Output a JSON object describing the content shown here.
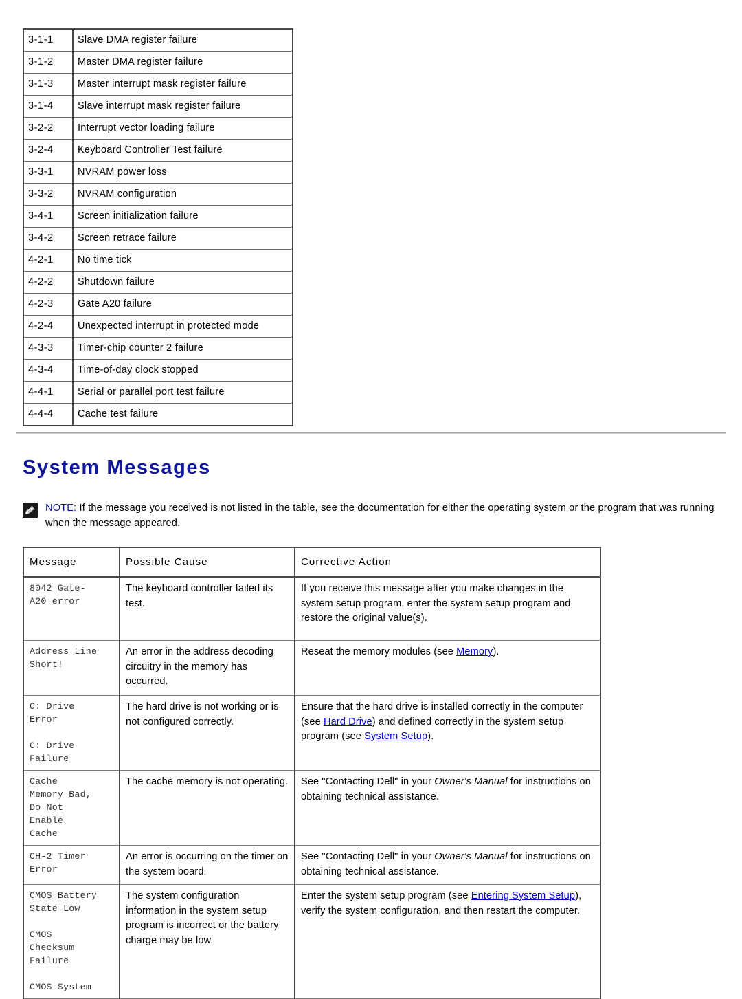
{
  "beep_table": {
    "rows": [
      {
        "code": "3-1-1",
        "desc": "Slave DMA register failure"
      },
      {
        "code": "3-1-2",
        "desc": "Master DMA register failure"
      },
      {
        "code": "3-1-3",
        "desc": "Master interrupt mask register failure"
      },
      {
        "code": "3-1-4",
        "desc": "Slave interrupt mask register failure"
      },
      {
        "code": "3-2-2",
        "desc": "Interrupt vector loading failure"
      },
      {
        "code": "3-2-4",
        "desc": "Keyboard Controller Test failure"
      },
      {
        "code": "3-3-1",
        "desc": "NVRAM power loss"
      },
      {
        "code": "3-3-2",
        "desc": "NVRAM configuration"
      },
      {
        "code": "3-4-1",
        "desc": "Screen initialization failure"
      },
      {
        "code": "3-4-2",
        "desc": "Screen retrace failure"
      },
      {
        "code": "4-2-1",
        "desc": "No time tick"
      },
      {
        "code": "4-2-2",
        "desc": "Shutdown failure"
      },
      {
        "code": "4-2-3",
        "desc": "Gate A20 failure"
      },
      {
        "code": "4-2-4",
        "desc": "Unexpected interrupt in protected mode"
      },
      {
        "code": "4-3-3",
        "desc": "Timer-chip counter 2 failure"
      },
      {
        "code": "4-3-4",
        "desc": "Time-of-day clock stopped"
      },
      {
        "code": "4-4-1",
        "desc": "Serial or parallel port test failure"
      },
      {
        "code": "4-4-4",
        "desc": "Cache test failure"
      }
    ]
  },
  "heading": "System Messages",
  "note": {
    "label": "NOTE:",
    "text": " If the message you received is not listed in the table, see the documentation for either the operating system or the program that was running when the message appeared.",
    "icon": "note-pencil-icon"
  },
  "messages_table": {
    "headers": [
      "Message",
      "Possible Cause",
      "Corrective Action"
    ],
    "rows": [
      {
        "message": "8042 Gate-\nA20 error",
        "cause": "The keyboard controller failed its test.",
        "action_parts": [
          {
            "type": "text",
            "value": "If you receive this message after you make changes in the system setup program, enter the system setup program and restore the original value(s)."
          }
        ]
      },
      {
        "message": "Address Line\nShort!",
        "cause": "An error in the address decoding circuitry in the memory has occurred.",
        "action_parts": [
          {
            "type": "text",
            "value": "Reseat the memory modules (see "
          },
          {
            "type": "link",
            "value": "Memory"
          },
          {
            "type": "text",
            "value": ")."
          }
        ]
      },
      {
        "message": "C: Drive\nError\n\nC: Drive\nFailure",
        "cause": "The hard drive is not working or is not configured correctly.",
        "action_parts": [
          {
            "type": "text",
            "value": "Ensure that the hard drive is installed correctly in the computer (see "
          },
          {
            "type": "link",
            "value": "Hard Drive"
          },
          {
            "type": "text",
            "value": ") and defined correctly in the system setup program (see "
          },
          {
            "type": "link",
            "value": "System Setup"
          },
          {
            "type": "text",
            "value": ")."
          }
        ]
      },
      {
        "message": "Cache\nMemory Bad,\nDo Not\nEnable\nCache",
        "cause": "The cache memory is not operating.",
        "action_parts": [
          {
            "type": "text",
            "value": "See \"Contacting Dell\" in your "
          },
          {
            "type": "italic",
            "value": "Owner's Manual"
          },
          {
            "type": "text",
            "value": " for instructions on obtaining technical assistance."
          }
        ]
      },
      {
        "message": "CH-2 Timer\nError",
        "cause": "An error is occurring on the timer on the system board.",
        "action_parts": [
          {
            "type": "text",
            "value": "See \"Contacting Dell\" in your "
          },
          {
            "type": "italic",
            "value": "Owner's Manual"
          },
          {
            "type": "text",
            "value": " for instructions on obtaining technical assistance."
          }
        ]
      },
      {
        "message": "CMOS Battery\nState Low\n\nCMOS\nChecksum\nFailure\n\nCMOS System",
        "cause": "The system configuration information in the system setup program is incorrect or the battery charge may be low.",
        "action_parts": [
          {
            "type": "text",
            "value": "Enter the system setup program (see "
          },
          {
            "type": "link",
            "value": "Entering System Setup"
          },
          {
            "type": "text",
            "value": "), verify the system configuration, and then restart the computer."
          }
        ]
      }
    ]
  },
  "colors": {
    "heading": "#11179b",
    "link": "#0000d0",
    "rule": "#9a9a9a",
    "table_border": "#4a4a4a"
  }
}
